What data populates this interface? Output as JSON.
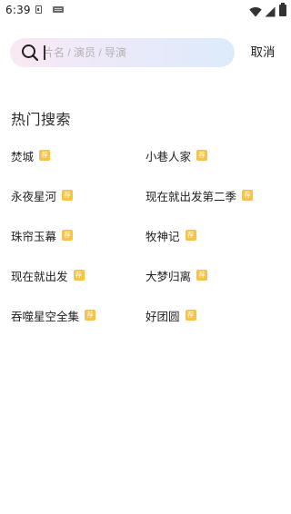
{
  "status_bar": {
    "time": "6:39",
    "battery_level": 1.0,
    "icons": [
      "sim-icon",
      "keyboard-icon",
      "wifi-icon",
      "signal-icon",
      "battery-icon"
    ]
  },
  "search": {
    "icon": "search-icon",
    "placeholder": "片名 / 演员 / 导演",
    "value": "",
    "cancel_label": "取消"
  },
  "hot_search": {
    "title": "热门搜索",
    "badge_label": "荐",
    "badge_color": "#f5c24a",
    "items": [
      {
        "label": "焚城"
      },
      {
        "label": "小巷人家"
      },
      {
        "label": "永夜星河"
      },
      {
        "label": "现在就出发第二季"
      },
      {
        "label": "珠帘玉幕"
      },
      {
        "label": "牧神记"
      },
      {
        "label": "现在就出发"
      },
      {
        "label": "大梦归离"
      },
      {
        "label": "吞噬星空全集"
      },
      {
        "label": "好团圆"
      }
    ]
  }
}
